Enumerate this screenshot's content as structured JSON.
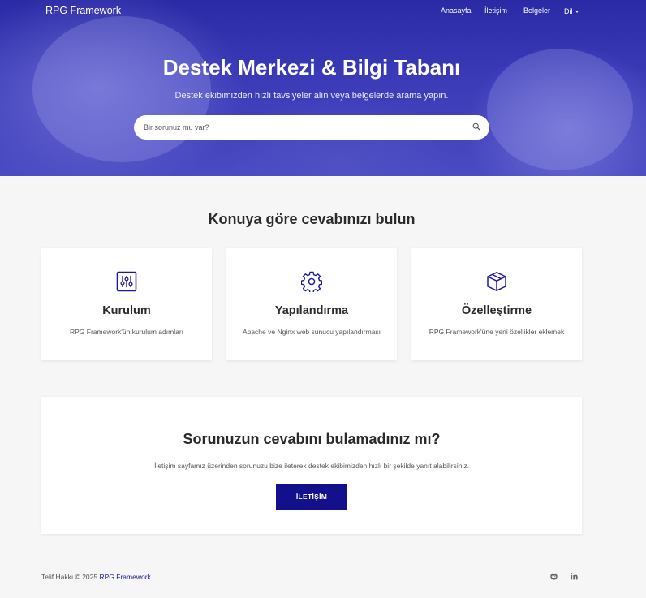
{
  "header": {
    "brand": "RPG Framework",
    "nav": [
      {
        "label": "Anasayfa"
      },
      {
        "label": "İletişim"
      },
      {
        "label": "Belgeler"
      },
      {
        "label": "Dil"
      }
    ]
  },
  "hero": {
    "title": "Destek Merkezi & Bilgi Tabanı",
    "subtitle": "Destek ekibimizden hızlı tavsiyeler alın veya belgelerde arama yapın.",
    "search_placeholder": "Bir sorunuz mu var?",
    "search_icon": "search-icon"
  },
  "topics": {
    "title": "Konuya göre cevabınızı bulun",
    "cards": [
      {
        "icon": "sliders-icon",
        "title": "Kurulum",
        "description": "RPG Framework'ün kurulum adımları"
      },
      {
        "icon": "gear-icon",
        "title": "Yapılandırma",
        "description": "Apache ve Nginx web sunucu yapılandırması"
      },
      {
        "icon": "box-icon",
        "title": "Özelleştirme",
        "description": "RPG Framework'üne yeni özellikler eklemek"
      }
    ]
  },
  "cta": {
    "title": "Sorunuzun cevabını bulamadınız mı?",
    "description": "İletişim sayfamız üzerinden sorunuzu bize ileterek destek ekibimizden hızlı bir şekilde yanıt alabilirsiniz.",
    "button_label": "İLETİŞİM"
  },
  "footer": {
    "copyright": "Telif Hakkı © 2025",
    "brand_link": "RPG Framework",
    "social_icons": [
      "github-icon",
      "linkedin-icon"
    ]
  },
  "colors": {
    "accent": "#12108a",
    "hero": "#3535b3"
  }
}
